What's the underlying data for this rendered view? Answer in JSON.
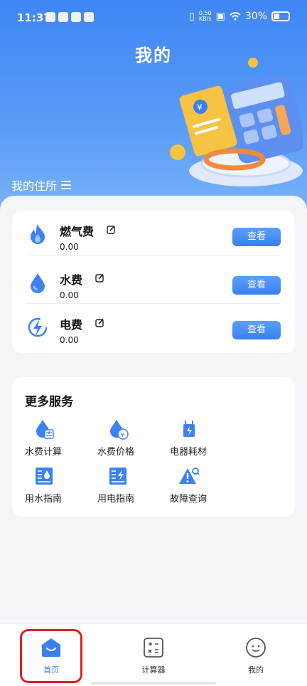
{
  "status_bar": {
    "time": "11:37",
    "net_speed_value": "0.50",
    "net_speed_unit": "KB/s",
    "battery": "30%"
  },
  "header": {
    "title": "我的",
    "residence_label": "我的住所"
  },
  "bills": [
    {
      "name": "燃气费",
      "amount": "0.00",
      "button": "查看",
      "icon": "flame-icon"
    },
    {
      "name": "水费",
      "amount": "0.00",
      "button": "查看",
      "icon": "water-drop-icon"
    },
    {
      "name": "电费",
      "amount": "0.00",
      "button": "查看",
      "icon": "lightning-icon"
    }
  ],
  "services": {
    "title": "更多服务",
    "items": [
      {
        "label": "水费计算",
        "icon": "water-calculator-icon"
      },
      {
        "label": "水费价格",
        "icon": "water-price-icon"
      },
      {
        "label": "电器耗材",
        "icon": "appliance-icon"
      },
      {
        "label": "用水指南",
        "icon": "water-guide-icon"
      },
      {
        "label": "用电指南",
        "icon": "electric-guide-icon"
      },
      {
        "label": "故障查询",
        "icon": "fault-warning-icon"
      }
    ]
  },
  "tabbar": {
    "items": [
      {
        "label": "首页",
        "icon": "home-icon",
        "active": true
      },
      {
        "label": "计算器",
        "icon": "calculator-icon",
        "active": false
      },
      {
        "label": "我的",
        "icon": "smiley-icon",
        "active": false
      }
    ]
  },
  "colors": {
    "accent": "#3a7ff1",
    "header_gradient_top": "#3f86f5",
    "highlight": "#d8202a"
  }
}
